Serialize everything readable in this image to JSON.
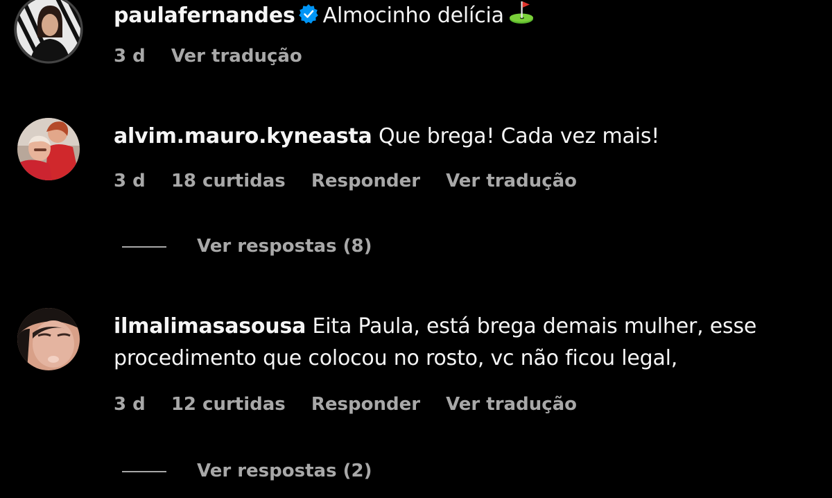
{
  "comments": [
    {
      "username": "paulafernandes",
      "verified": true,
      "text": "Almocinho delícia",
      "emoji_icon": "golf-flag-icon",
      "time": "3 d",
      "translate": "Ver tradução"
    },
    {
      "username": "alvim.mauro.kyneasta",
      "text": "Que brega! Cada vez mais!",
      "time": "3 d",
      "likes": "18 curtidas",
      "reply": "Responder",
      "translate": "Ver tradução",
      "view_replies": "Ver respostas (8)"
    },
    {
      "username": "ilmalimasasousa",
      "text": "Eita Paula, está brega demais mulher, esse procedimento que colocou no rosto, vc não ficou legal,",
      "time": "3 d",
      "likes": "12 curtidas",
      "reply": "Responder",
      "translate": "Ver tradução",
      "view_replies": "Ver respostas (2)"
    }
  ],
  "colors": {
    "background": "#000000",
    "primary_text": "#f5f5f5",
    "secondary_text": "#a8a8a8",
    "verified_blue": "#0095f6"
  }
}
